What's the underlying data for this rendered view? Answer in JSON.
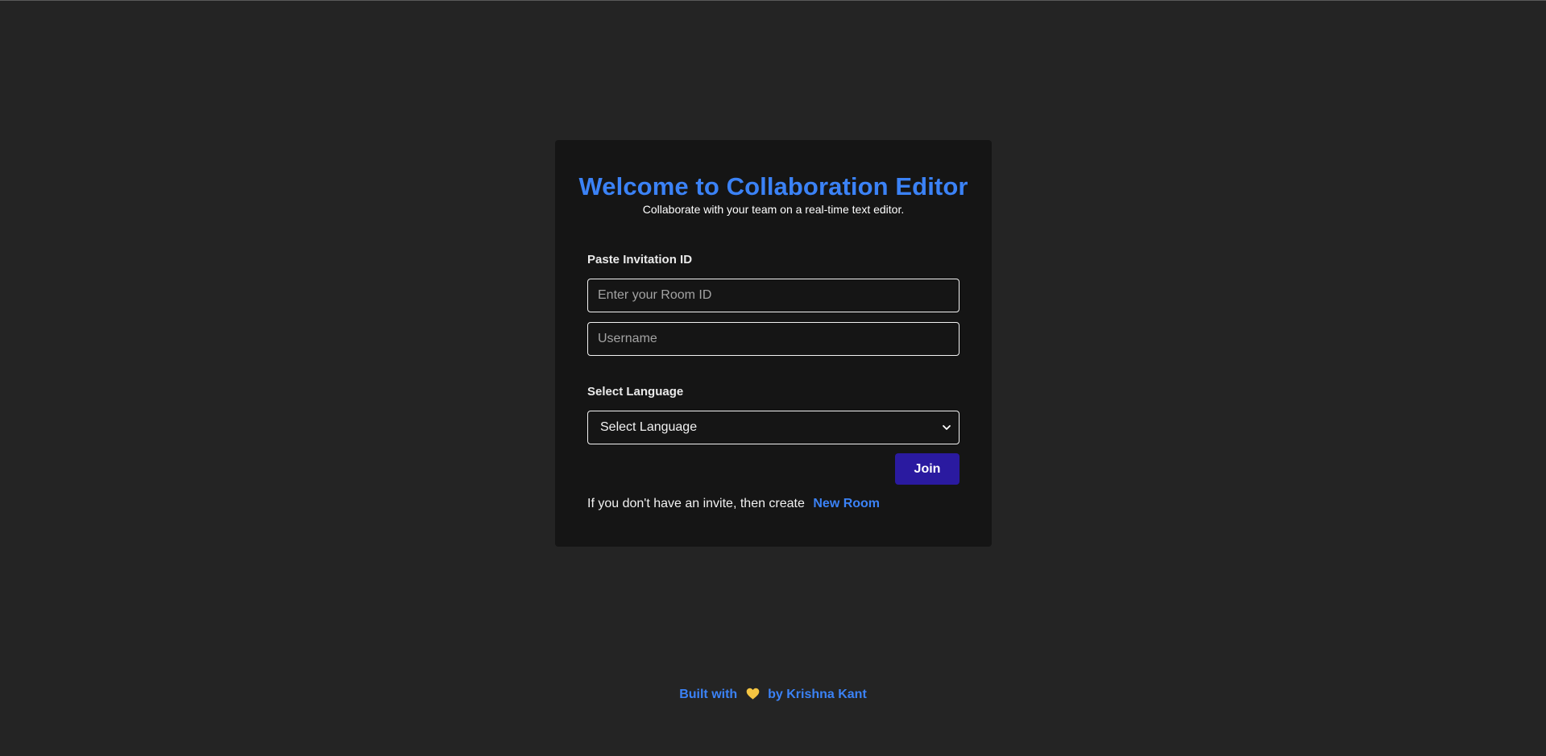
{
  "card": {
    "title": "Welcome to Collaboration Editor",
    "subtitle": "Collaborate with your team on a real-time text editor."
  },
  "form": {
    "invite_label": "Paste Invitation ID",
    "room_id": {
      "value": "",
      "placeholder": "Enter your Room ID"
    },
    "username": {
      "value": "",
      "placeholder": "Username"
    },
    "language_label": "Select Language",
    "language_select": {
      "selected": "Select Language",
      "icon": "chevron-down-icon"
    },
    "join_label": "Join"
  },
  "create_prompt": {
    "text": "If you don't have an invite, then create",
    "link_label": "New Room"
  },
  "footer": {
    "prefix": "Built with",
    "icon": "heart-icon",
    "suffix": "by Krishna Kant"
  },
  "colors": {
    "page_background": "#242424",
    "card_background": "#151515",
    "accent": "#3b82f6",
    "button": "#2a1aa0",
    "heart": "#f5c542"
  }
}
